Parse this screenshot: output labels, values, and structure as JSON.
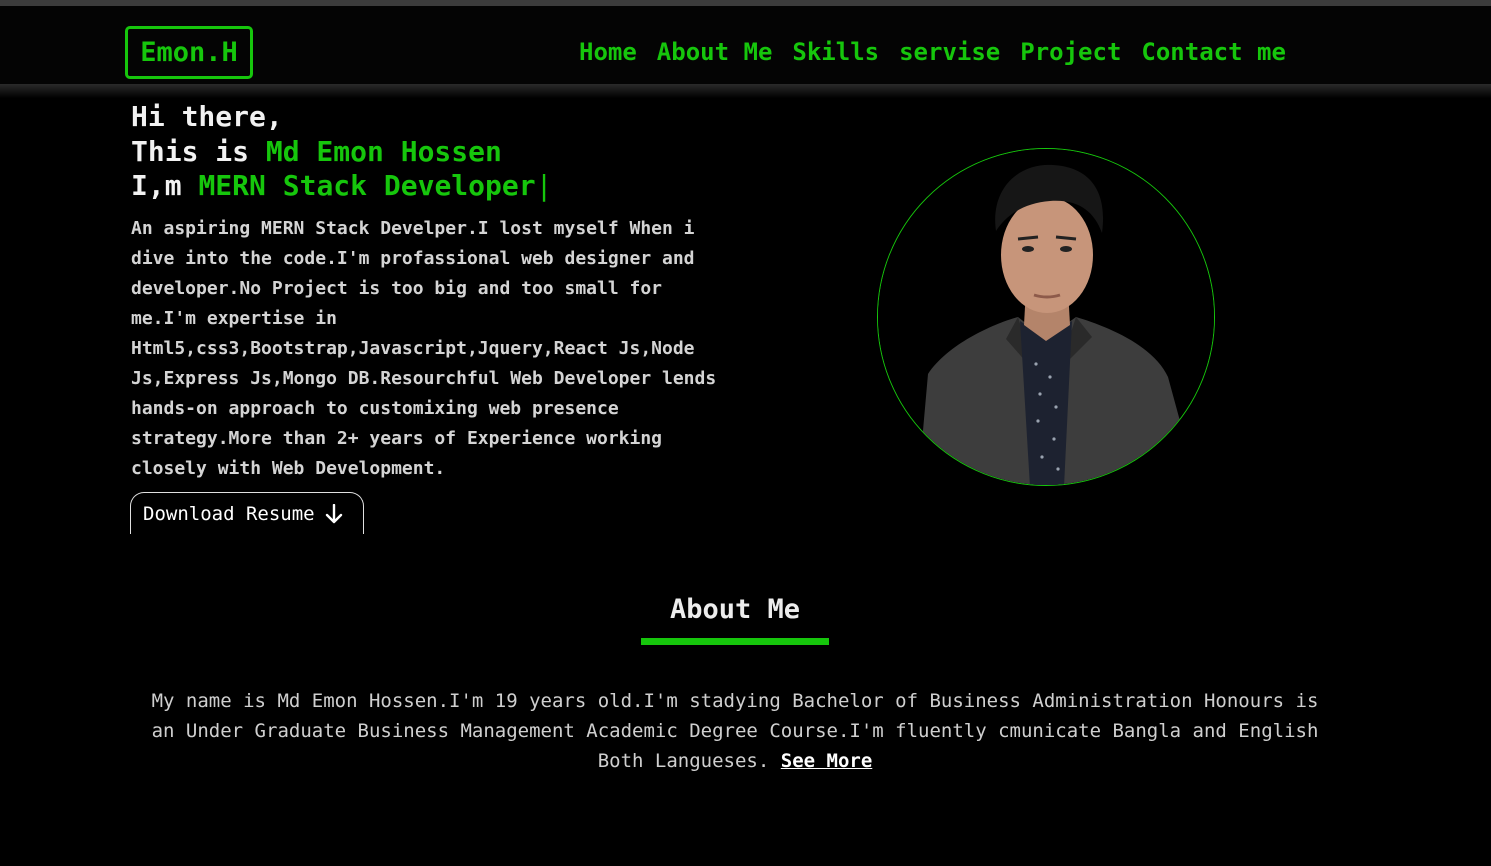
{
  "brand": {
    "logo": "Emon.H",
    "accent_color": "#16c60c"
  },
  "nav": {
    "items": [
      "Home",
      "About Me",
      "Skills",
      "servise",
      "Project",
      "Contact me"
    ]
  },
  "hero": {
    "line1": "Hi there,",
    "line2_prefix": "This is ",
    "name": "Md Emon Hossen",
    "line3_prefix": "I,m ",
    "role": "MERN Stack Developer",
    "cursor": "|",
    "intro": "An aspiring MERN Stack Develper.I lost myself When i dive into the code.I'm profassional web designer and developer.No Project is too big and too small for me.I'm expertise in Html5,css3,Bootstrap,Javascript,Jquery,React Js,Node Js,Express Js,Mongo DB.Resourchful Web Developer lends hands-on approach to customixing web presence strategy.More than 2+ years of Experience working closely with Web Development.",
    "resume_button": "Download Resume",
    "resume_icon": "arrow-down-icon"
  },
  "profile": {
    "photo": "profile-photo"
  },
  "about": {
    "title": "About Me",
    "text": "My name is Md Emon Hossen.I'm 19 years old.I'm stadying Bachelor of Business Administration Honours is an Under Graduate Business Management Academic Degree Course.I'm fluently cmunicate Bangla and English Both Langueses.",
    "see_more": "See More"
  }
}
